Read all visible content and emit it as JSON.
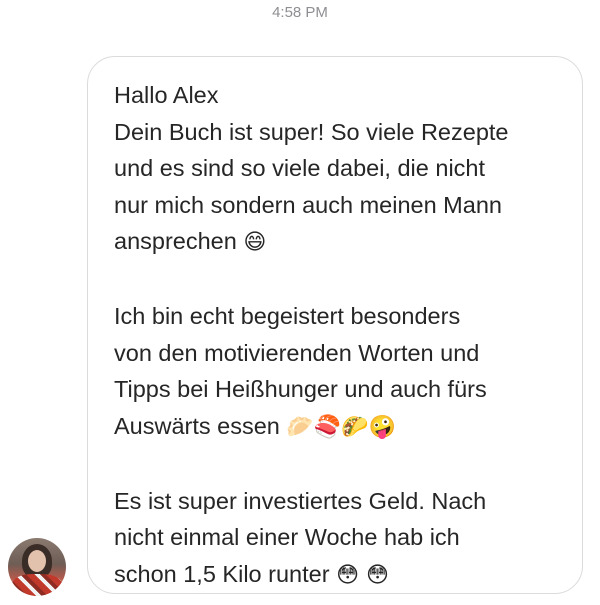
{
  "chat": {
    "timestamp": "4:58 PM",
    "message": {
      "paragraph_1": "Hallo Alex\nDein Buch ist super! So viele Rezepte\nund es sind so viele dabei, die nicht\nnur mich sondern auch meinen Mann\nansprechen",
      "paragraph_1_emoji": "😄",
      "paragraph_2": "Ich bin echt begeistert besonders\nvon den motivierenden Worten und\nTipps bei Heißhunger und auch fürs\nAuswärts essen",
      "paragraph_2_emoji": "🥟🍣🌮🤪",
      "paragraph_3": "Es ist super investiertes Geld. Nach\nnicht einmal einer Woche hab ich\nschon 1,5 Kilo runter",
      "paragraph_3_emoji": "😳 😳"
    },
    "sender": {
      "avatar_icon": "profile-photo"
    }
  }
}
